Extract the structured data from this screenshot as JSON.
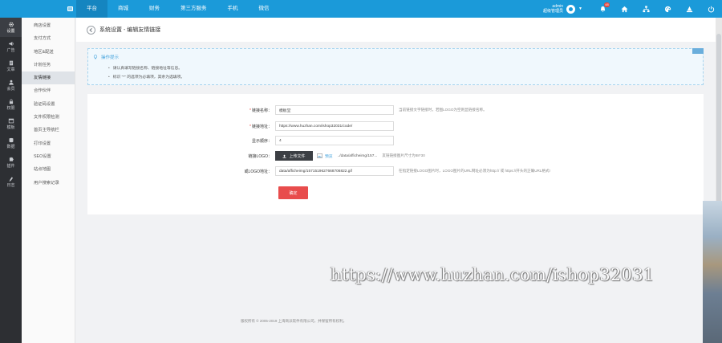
{
  "topnav": {
    "tabs": [
      {
        "label": "平台",
        "active": true
      },
      {
        "label": "商城",
        "active": false
      },
      {
        "label": "财务",
        "active": false
      },
      {
        "label": "第三方服务",
        "active": false
      },
      {
        "label": "手机",
        "active": false
      },
      {
        "label": "微信",
        "active": false
      }
    ],
    "user_name": "admin",
    "user_role": "超级管理员",
    "notification_count": "48",
    "icons": [
      "bell-icon",
      "home-icon",
      "sitemap-icon",
      "palette-icon",
      "cap-icon",
      "power-icon"
    ]
  },
  "rail": {
    "items": [
      {
        "label": "设置",
        "icon": "gear-icon",
        "active": true
      },
      {
        "label": "广告",
        "icon": "megaphone-icon",
        "active": false
      },
      {
        "label": "文章",
        "icon": "document-icon",
        "active": false
      },
      {
        "label": "会员",
        "icon": "user-icon",
        "active": false
      },
      {
        "label": "权限",
        "icon": "lock-icon",
        "active": false
      },
      {
        "label": "模板",
        "icon": "template-icon",
        "active": false
      },
      {
        "label": "数据",
        "icon": "data-icon",
        "active": false
      },
      {
        "label": "插件",
        "icon": "puzzle-icon",
        "active": false
      },
      {
        "label": "日志",
        "icon": "log-icon",
        "active": false
      }
    ]
  },
  "submenu": {
    "items": [
      {
        "label": "商店设置",
        "active": false
      },
      {
        "label": "支付方式",
        "active": false
      },
      {
        "label": "地区&配送",
        "active": false
      },
      {
        "label": "计划任务",
        "active": false
      },
      {
        "label": "友情链接",
        "active": true
      },
      {
        "label": "合作伙伴",
        "active": false
      },
      {
        "label": "验证码设置",
        "active": false
      },
      {
        "label": "文件权限检测",
        "active": false
      },
      {
        "label": "首页主导航栏",
        "active": false
      },
      {
        "label": "打印设置",
        "active": false
      },
      {
        "label": "SEO设置",
        "active": false
      },
      {
        "label": "站点地图",
        "active": false
      },
      {
        "label": "用户搜索记录",
        "active": false
      }
    ]
  },
  "header": {
    "title": "系统设置 - 编辑友情链接"
  },
  "tips": {
    "title": "操作提示",
    "lines": [
      "请认真填写链接名称、链接地址等信息。",
      "标识 \"*\" 的选项为必填项，其余为选填项。"
    ]
  },
  "form": {
    "link_name": {
      "label": "链接名称：",
      "required": true,
      "value": "模板堂",
      "hint": "当前链接文字链接时，若图LOGO为空则显链接名称。"
    },
    "link_url": {
      "label": "链接地址：",
      "required": true,
      "value": "https://www.huzhan.com/ishop32031/code/",
      "hint": ""
    },
    "sort_order": {
      "label": "显示顺序：",
      "required": false,
      "value": "4",
      "hint": ""
    },
    "logo": {
      "label": "链接LOGO：",
      "button": "上传文件",
      "preview": "预览",
      "path": "../data/afficheimg/157...",
      "hint": "友链链接图片尺寸为88*30"
    },
    "logo_url": {
      "label": "或LOGO地址：",
      "value": "data/afficheimg/1571519627668706822.gif",
      "hint": "在指定链接LOGO图片时，LOGO图片的URL网址必须为http:// 或 https://开头的正确URL格式!"
    },
    "submit_label": "确定"
  },
  "watermark": "https://www.huzhan.com/ishop32031",
  "footer": "版权所有 © 2005-2019 上海商派软件有限公司，并保留所有权利。"
}
